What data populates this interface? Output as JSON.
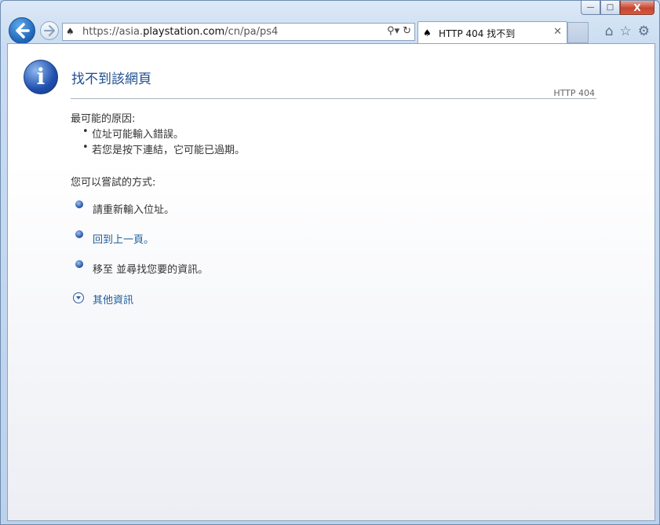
{
  "browser": {
    "address_prefix": "https://asia.",
    "address_domain": "playstation.com",
    "address_path": "/cn/pa/ps4",
    "tab_title": "HTTP 404 找不到",
    "caption": {
      "minimize": "—",
      "maximize": "□",
      "close": "X"
    }
  },
  "page": {
    "title": "找不到該網頁",
    "code": "HTTP 404",
    "causes_heading": "最可能的原因:",
    "causes": [
      "位址可能輸入錯誤。",
      "若您是按下連結，它可能已過期。"
    ],
    "options_heading": "您可以嘗試的方式:",
    "options": [
      "請重新輸入位址。",
      "回到上一頁。",
      "移至  並尋找您要的資訊。"
    ],
    "more_info": "其他資訊"
  },
  "colors": {
    "link": "#1f5d9c",
    "title": "#1f4f8f"
  }
}
